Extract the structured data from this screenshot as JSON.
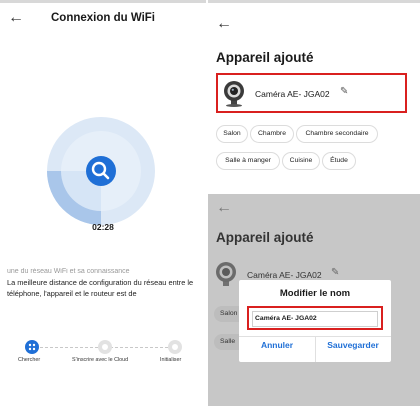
{
  "left": {
    "title": "Connexion du WiFi",
    "back_glyph": "←",
    "timer": "02:28",
    "cutoff_text": "une du réseau WiFi et sa connaissance",
    "description": "La meilleure distance de configuration du réseau entre le téléphone, l'appareil et le routeur est de",
    "steps": [
      {
        "label": "Chercher",
        "icon": "search-step-icon",
        "state": "active"
      },
      {
        "label": "S'inscrire avec le Cloud",
        "icon": "cloud-step-icon",
        "state": "inactive"
      },
      {
        "label": "Initialiser",
        "icon": "init-step-icon",
        "state": "inactive"
      }
    ],
    "colors": {
      "accent": "#1f6fd6",
      "ring_light": "#dce8f6",
      "ring_sweep": "#a9c6ea"
    }
  },
  "right_top": {
    "back_glyph": "←",
    "heading": "Appareil ajouté",
    "device_name": "Caméra AE-  JGA02",
    "edit_glyph": "✎",
    "rooms": [
      "Salon",
      "Chambre",
      "Chambre secondaire",
      "Salle à manger",
      "Cuisine",
      "Étude"
    ],
    "highlight_color": "#d9201f"
  },
  "right_bottom": {
    "back_glyph": "←",
    "heading": "Appareil ajouté",
    "device_name": "Caméra AE-  JGA02",
    "edit_glyph": "✎",
    "rooms_partial": [
      "Salon",
      "Salle"
    ],
    "dialog": {
      "title": "Modifier le nom",
      "input_value": "Caméra AE-  JGA02",
      "cancel": "Annuler",
      "save": "Sauvegarder"
    },
    "overlay_color": "#c7c7c7"
  }
}
